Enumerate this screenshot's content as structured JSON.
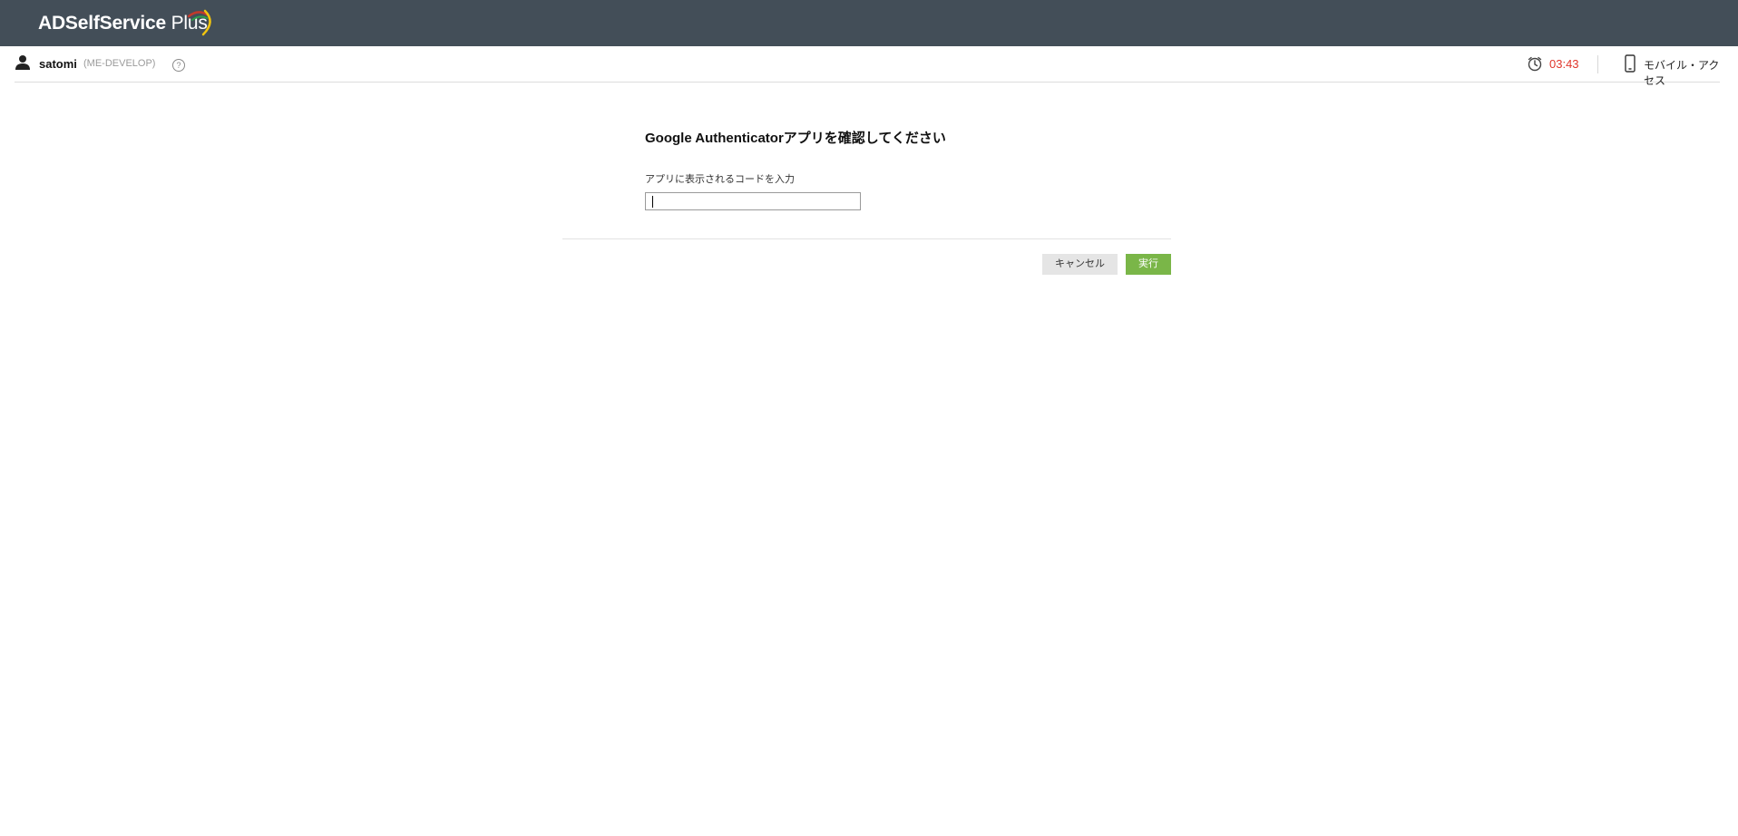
{
  "header": {
    "logo_bold": "ADSelfService",
    "logo_light": "Plus",
    "bg_color": "#434e58"
  },
  "userbar": {
    "user_icon": "user-icon",
    "username": "satomi",
    "domain": "(ME-DEVELOP)",
    "help_icon": "help-icon",
    "help_glyph": "?",
    "timer_icon": "clock-icon",
    "timer": "03:43",
    "timer_color": "#e0362b",
    "mobile_icon": "mobile-phone-icon",
    "mobile_label": "モバイル・アクセス"
  },
  "form": {
    "title": "Google Authenticatorアプリを確認してください",
    "code_label": "アプリに表示されるコードを入力",
    "code_value": "",
    "cancel_label": "キャンセル",
    "submit_label": "実行",
    "submit_color": "#7ab648"
  }
}
